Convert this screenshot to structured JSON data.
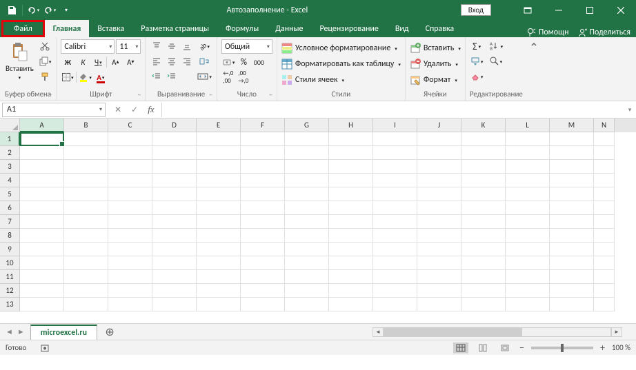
{
  "titlebar": {
    "title": "Автозаполнение  -  Excel",
    "login": "Вход"
  },
  "tabs": {
    "file": "Файл",
    "items": [
      "Главная",
      "Вставка",
      "Разметка страницы",
      "Формулы",
      "Данные",
      "Рецензирование",
      "Вид",
      "Справка"
    ],
    "help": "Помощн",
    "share": "Поделиться"
  },
  "ribbon": {
    "clipboard": {
      "label": "Буфер обмена",
      "paste": "Вставить"
    },
    "font": {
      "label": "Шрифт",
      "name": "Calibri",
      "size": "11",
      "bold": "Ж",
      "italic": "К",
      "underline": "Ч"
    },
    "align": {
      "label": "Выравнивание"
    },
    "number": {
      "label": "Число",
      "format": "Общий"
    },
    "styles": {
      "label": "Стили",
      "cond": "Условное форматирование",
      "table": "Форматировать как таблицу",
      "cell": "Стили ячеек"
    },
    "cells": {
      "label": "Ячейки",
      "insert": "Вставить",
      "delete": "Удалить",
      "format": "Формат"
    },
    "editing": {
      "label": "Редактирование"
    }
  },
  "formula": {
    "activeCell": "A1"
  },
  "cols": [
    "A",
    "B",
    "C",
    "D",
    "E",
    "F",
    "G",
    "H",
    "I",
    "J",
    "K",
    "L",
    "M",
    "N"
  ],
  "rows": [
    "1",
    "2",
    "3",
    "4",
    "5",
    "6",
    "7",
    "8",
    "9",
    "10",
    "11",
    "12",
    "13"
  ],
  "sheet": {
    "name": "microexcel.ru"
  },
  "status": {
    "ready": "Готово",
    "zoom": "100 %"
  }
}
